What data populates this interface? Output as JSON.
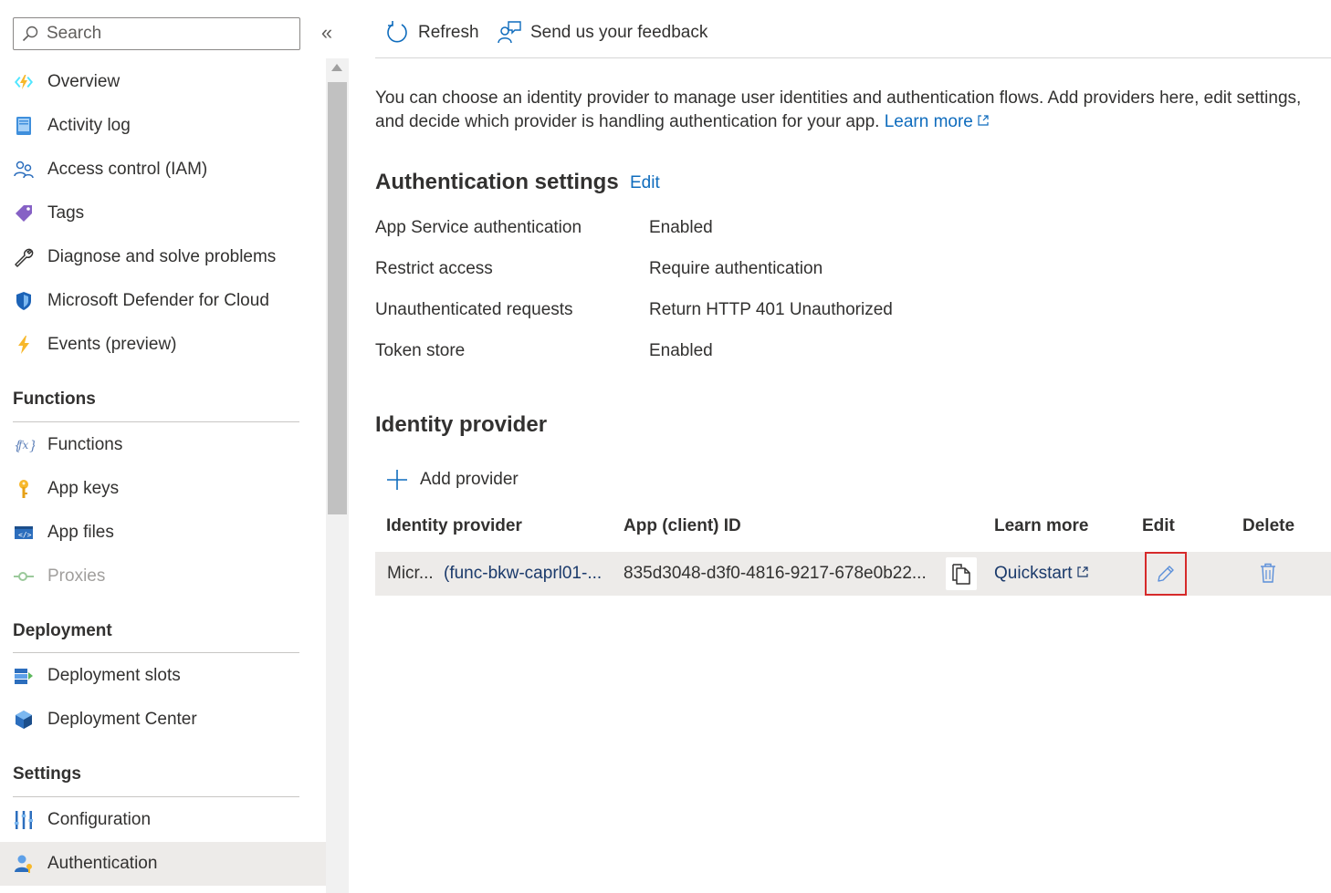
{
  "sidebar": {
    "search_placeholder": "Search",
    "collapse_glyph": "«",
    "items_top": [
      {
        "label": "Overview",
        "icon": "function-app-icon"
      },
      {
        "label": "Activity log",
        "icon": "activity-log-icon"
      },
      {
        "label": "Access control (IAM)",
        "icon": "people-icon"
      },
      {
        "label": "Tags",
        "icon": "tag-icon"
      },
      {
        "label": "Diagnose and solve problems",
        "icon": "wrench-icon"
      },
      {
        "label": "Microsoft Defender for Cloud",
        "icon": "shield-icon"
      },
      {
        "label": "Events (preview)",
        "icon": "lightning-icon"
      }
    ],
    "sections": {
      "functions": {
        "title": "Functions",
        "items": [
          {
            "label": "Functions",
            "icon": "fx-icon"
          },
          {
            "label": "App keys",
            "icon": "key-icon"
          },
          {
            "label": "App files",
            "icon": "code-file-icon"
          },
          {
            "label": "Proxies",
            "icon": "proxy-icon",
            "disabled": true
          }
        ]
      },
      "deployment": {
        "title": "Deployment",
        "items": [
          {
            "label": "Deployment slots",
            "icon": "slots-icon"
          },
          {
            "label": "Deployment Center",
            "icon": "cube-icon"
          }
        ]
      },
      "settings": {
        "title": "Settings",
        "items": [
          {
            "label": "Configuration",
            "icon": "sliders-icon"
          },
          {
            "label": "Authentication",
            "icon": "user-key-icon",
            "selected": true
          }
        ]
      }
    }
  },
  "toolbar": {
    "refresh_label": "Refresh",
    "feedback_label": "Send us your feedback"
  },
  "intro": {
    "text": "You can choose an identity provider to manage user identities and authentication flows. Add providers here, edit settings, and decide which provider is handling authentication for your app.",
    "learn_more": "Learn more"
  },
  "auth_settings": {
    "title": "Authentication settings",
    "edit_label": "Edit",
    "rows": [
      {
        "key": "App Service authentication",
        "value": "Enabled"
      },
      {
        "key": "Restrict access",
        "value": "Require authentication"
      },
      {
        "key": "Unauthenticated requests",
        "value": "Return HTTP 401 Unauthorized"
      },
      {
        "key": "Token store",
        "value": "Enabled"
      }
    ]
  },
  "identity_provider": {
    "title": "Identity provider",
    "add_label": "Add provider",
    "columns": {
      "provider": "Identity provider",
      "client_id": "App (client) ID",
      "learn_more": "Learn more",
      "edit": "Edit",
      "delete": "Delete"
    },
    "rows": [
      {
        "provider_name": "Micr...",
        "provider_app": "(func-bkw-caprl01-...",
        "client_id": "835d3048-d3f0-4816-9217-678e0b22...",
        "learn_more": "Quickstart"
      }
    ]
  },
  "colors": {
    "link": "#0f6cbd",
    "highlight_border": "#d62a2a",
    "selected_bg": "#edebe9"
  }
}
